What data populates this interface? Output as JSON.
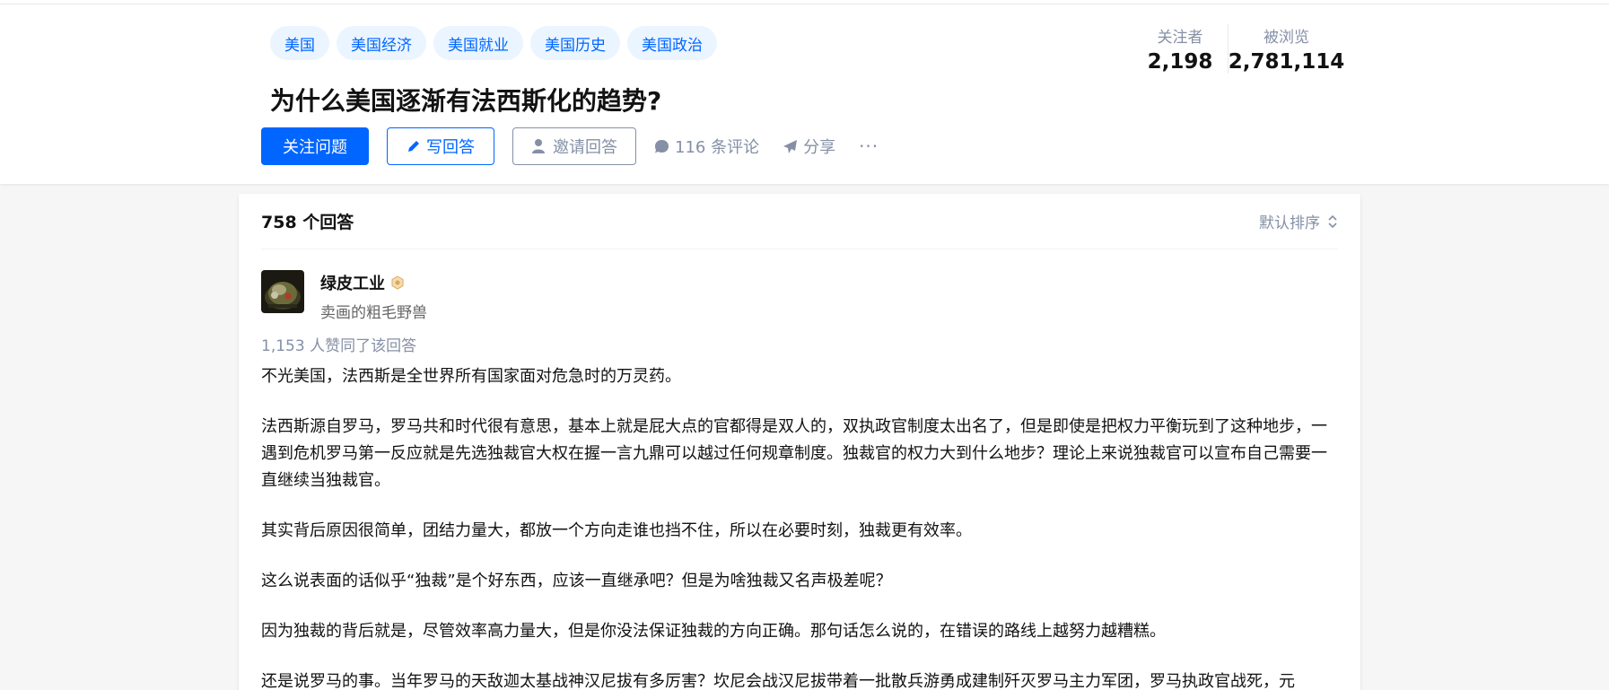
{
  "topics": [
    "美国",
    "美国经济",
    "美国就业",
    "美国历史",
    "美国政治"
  ],
  "question": {
    "title": "为什么美国逐渐有法西斯化的趋势?"
  },
  "actions": {
    "follow": "关注问题",
    "write": "写回答",
    "invite": "邀请回答",
    "comments": "116 条评论",
    "share": "分享",
    "more": "···"
  },
  "stats": {
    "followers_label": "关注者",
    "followers_value": "2,198",
    "views_label": "被浏览",
    "views_value": "2,781,114"
  },
  "answers": {
    "count": "758 个回答",
    "sort": "默认排序"
  },
  "answer": {
    "author_name": "绿皮工业",
    "author_headline": "卖画的粗毛野兽",
    "votes": "1,153 人赞同了该回答",
    "paragraphs": [
      "不光美国，法西斯是全世界所有国家面对危急时的万灵药。",
      "法西斯源自罗马，罗马共和时代很有意思，基本上就是屁大点的官都得是双人的，双执政官制度太出名了，但是即使是把权力平衡玩到了这种地步，一遇到危机罗马第一反应就是先选独裁官大权在握一言九鼎可以越过任何规章制度。独裁官的权力大到什么地步？理论上来说独裁官可以宣布自己需要一直继续当独裁官。",
      "其实背后原因很简单，团结力量大，都放一个方向走谁也挡不住，所以在必要时刻，独裁更有效率。",
      "这么说表面的话似乎“独裁”是个好东西，应该一直继承吧？但是为啥独裁又名声极差呢？",
      "因为独裁的背后就是，尽管效率高力量大，但是你没法保证独裁的方向正确。那句话怎么说的，在错误的路线上越努力越糟糕。",
      "还是说罗马的事。当年罗马的天敌迦太基战神汉尼拔有多厉害？坎尼会战汉尼拔带着一批散兵游勇成建制歼灭罗马主力军团，罗马执政官战死，元"
    ]
  },
  "colors": {
    "brand": "#0066ff",
    "topic_bg": "#ebf5ff",
    "muted": "#8590a6",
    "page_bg": "#f6f6f6"
  }
}
